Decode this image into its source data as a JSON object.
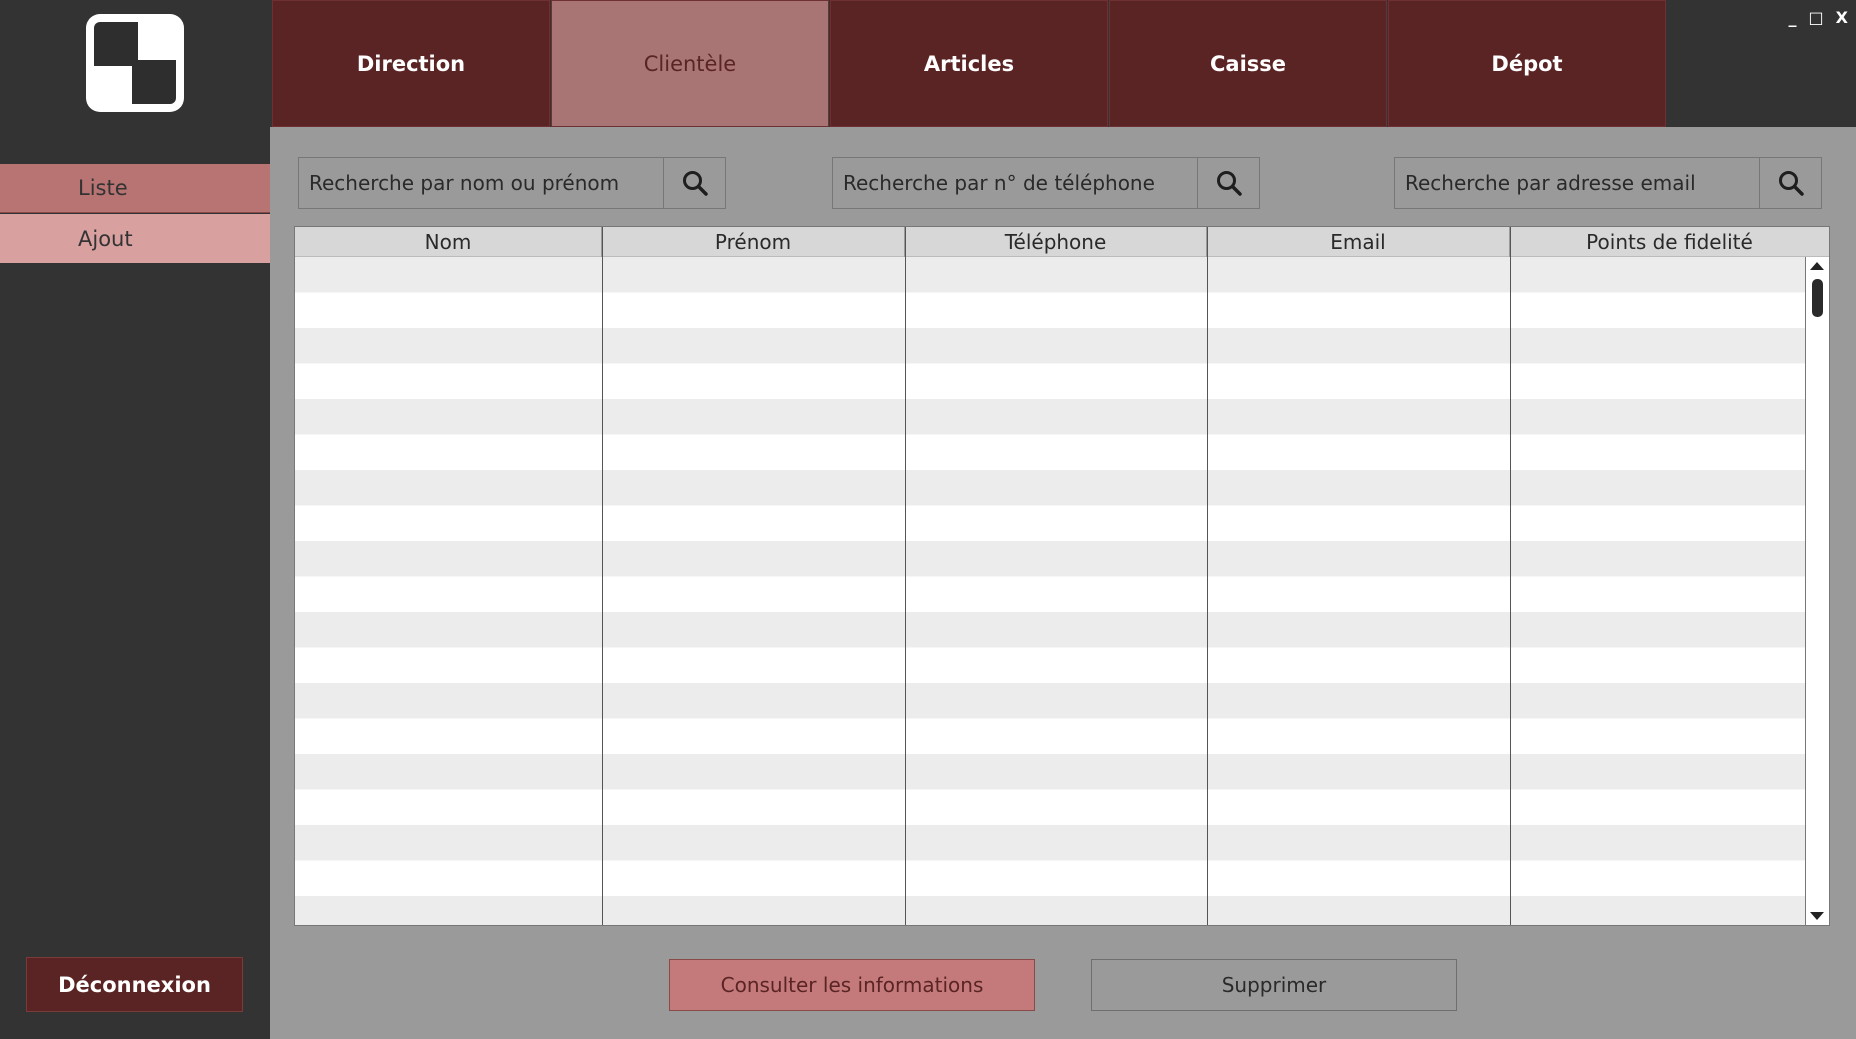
{
  "sidebar": {
    "items": [
      {
        "label": "Liste"
      },
      {
        "label": "Ajout"
      }
    ],
    "logout_label": "Déconnexion"
  },
  "tabs": [
    {
      "label": "Direction"
    },
    {
      "label": "Clientèle",
      "active": true
    },
    {
      "label": "Articles"
    },
    {
      "label": "Caisse"
    },
    {
      "label": "Dépot"
    }
  ],
  "window_controls": {
    "minimize": "_",
    "maximize": "□",
    "close": "X"
  },
  "search": {
    "name_placeholder": "Recherche par nom ou prénom",
    "phone_placeholder": "Recherche par n° de téléphone",
    "email_placeholder": "Recherche par adresse email",
    "icon": "search-icon"
  },
  "table": {
    "columns": [
      "Nom",
      "Prénom",
      "Téléphone",
      "Email",
      "Points de fidelité"
    ],
    "rows": []
  },
  "actions": {
    "consult_label": "Consulter les informations",
    "delete_label": "Supprimer"
  },
  "colors": {
    "tab_bg": "#5b2424",
    "tab_active_bg": "#a87474",
    "sidebar_bg": "#333333",
    "main_bg": "#9a9a9a",
    "accent_pink": "#d9a0a0"
  }
}
